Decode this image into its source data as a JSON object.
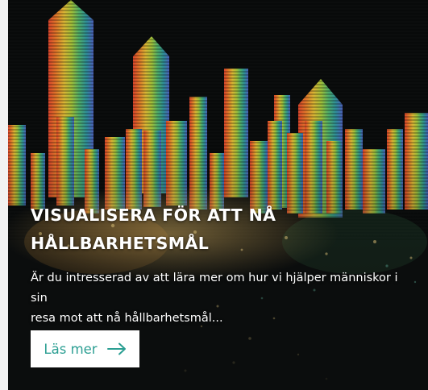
{
  "card": {
    "title_line1": "VISUALISERA FÖR ATT NÅ",
    "title_line2": "HÅLLBARHETSMÅL",
    "description_line1": "Är du intresserad av att lära mer om hur vi hjälper människor i sin",
    "description_line2": "resa mot att nå hållbarhetsmål...",
    "button_label": "Läs mer",
    "button_icon": "arrow-right-icon",
    "colors": {
      "background": "#0b0d0d",
      "button_text": "#2c9f93",
      "button_bg": "#ffffff",
      "page_bg": "#f2f2f2"
    }
  }
}
